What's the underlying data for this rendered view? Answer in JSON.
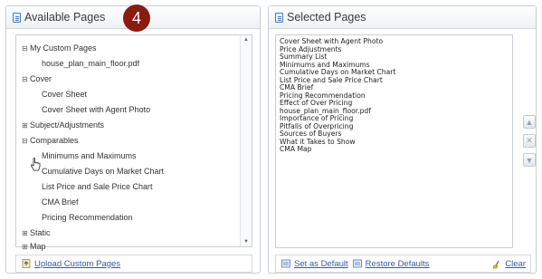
{
  "available": {
    "title": "Available Pages",
    "badge": "4",
    "upload_label": "Upload Custom Pages",
    "tree": [
      {
        "label": "My Custom Pages",
        "expander": "⊟"
      },
      {
        "label": "house_plan_main_floor.pdf"
      },
      {
        "label": "Cover",
        "expander": "⊟"
      },
      {
        "label": "Cover Sheet"
      },
      {
        "label": "Cover Sheet with Agent Photo"
      },
      {
        "label": "Subject/Adjustments",
        "expander": "⊞"
      },
      {
        "label": "Comparables",
        "expander": "⊟"
      },
      {
        "label": "Minimums and Maximums"
      },
      {
        "label": "Cumulative Days on Market Chart"
      },
      {
        "label": "List Price and Sale Price Chart"
      },
      {
        "label": "CMA Brief"
      },
      {
        "label": "Pricing Recommendation"
      },
      {
        "label": "Static",
        "expander": "⊞"
      },
      {
        "label": "Map",
        "expander": "⊞"
      }
    ]
  },
  "selected": {
    "title": "Selected Pages",
    "items": [
      "Cover Sheet with Agent Photo",
      "Price Adjustments",
      "Summary List",
      "Minimums and Maximums",
      "Cumulative Days on Market Chart",
      "List Price and Sale Price Chart",
      "CMA Brief",
      "Pricing Recommendation",
      "Effect of Over Pricing",
      "house_plan_main_floor.pdf",
      "Importance of Pricing",
      "Pitfalls of Overpricing",
      "Sources of Buyers",
      "What it Takes to Show",
      "CMA Map"
    ],
    "set_default_label": "Set as Default",
    "restore_label": "Restore Defaults",
    "clear_label": "Clear"
  },
  "colors": {
    "badge": "#8b1a0f",
    "link": "#2c5ea8",
    "border": "#c9cfd6"
  }
}
